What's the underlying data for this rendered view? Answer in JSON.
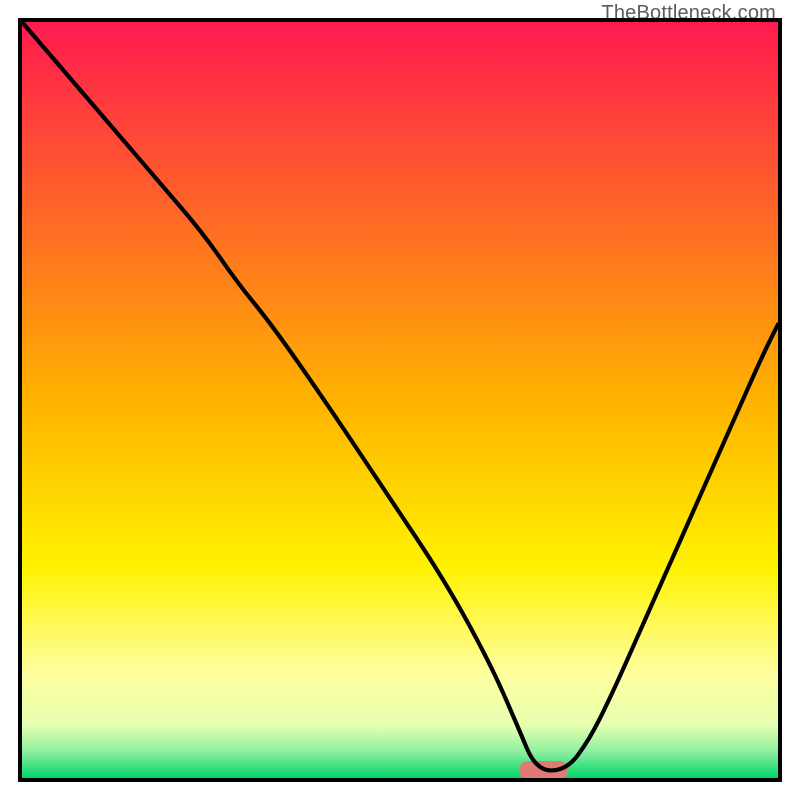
{
  "watermark": "TheBottleneck.com",
  "chart_data": {
    "type": "line",
    "title": "",
    "xlabel": "",
    "ylabel": "",
    "xlim": [
      0,
      100
    ],
    "ylim": [
      0,
      100
    ],
    "grid": false,
    "legend": false,
    "background_gradient": {
      "stops": [
        {
          "pos": 0.0,
          "color": "#ff1a4f"
        },
        {
          "pos": 0.5,
          "color": "#ffb200"
        },
        {
          "pos": 0.72,
          "color": "#fff200"
        },
        {
          "pos": 0.86,
          "color": "#ffff9e"
        },
        {
          "pos": 0.93,
          "color": "#e6ffb0"
        },
        {
          "pos": 0.965,
          "color": "#8ef0a0"
        },
        {
          "pos": 1.0,
          "color": "#00d668"
        }
      ]
    },
    "marker": {
      "x": 69,
      "y": 1,
      "width": 6.5,
      "height": 2.5,
      "color": "#e07a74",
      "shape": "rounded-rect"
    },
    "series": [
      {
        "name": "bottleneck-curve",
        "color": "#000000",
        "x": [
          0,
          6,
          12,
          18,
          24,
          28.5,
          33,
          40,
          48,
          56,
          62,
          65.5,
          68,
          72,
          75,
          78,
          82,
          86,
          90,
          94,
          98,
          100
        ],
        "y": [
          100,
          93,
          86,
          79,
          72,
          65.5,
          60,
          50,
          38,
          26,
          15,
          7,
          1,
          1,
          5,
          11,
          20,
          29,
          38,
          47,
          56,
          60
        ]
      }
    ],
    "notes": "Curve values are visual estimates read from the plot; axes have no tick labels so a 0–100 normalized coordinate system is used."
  }
}
